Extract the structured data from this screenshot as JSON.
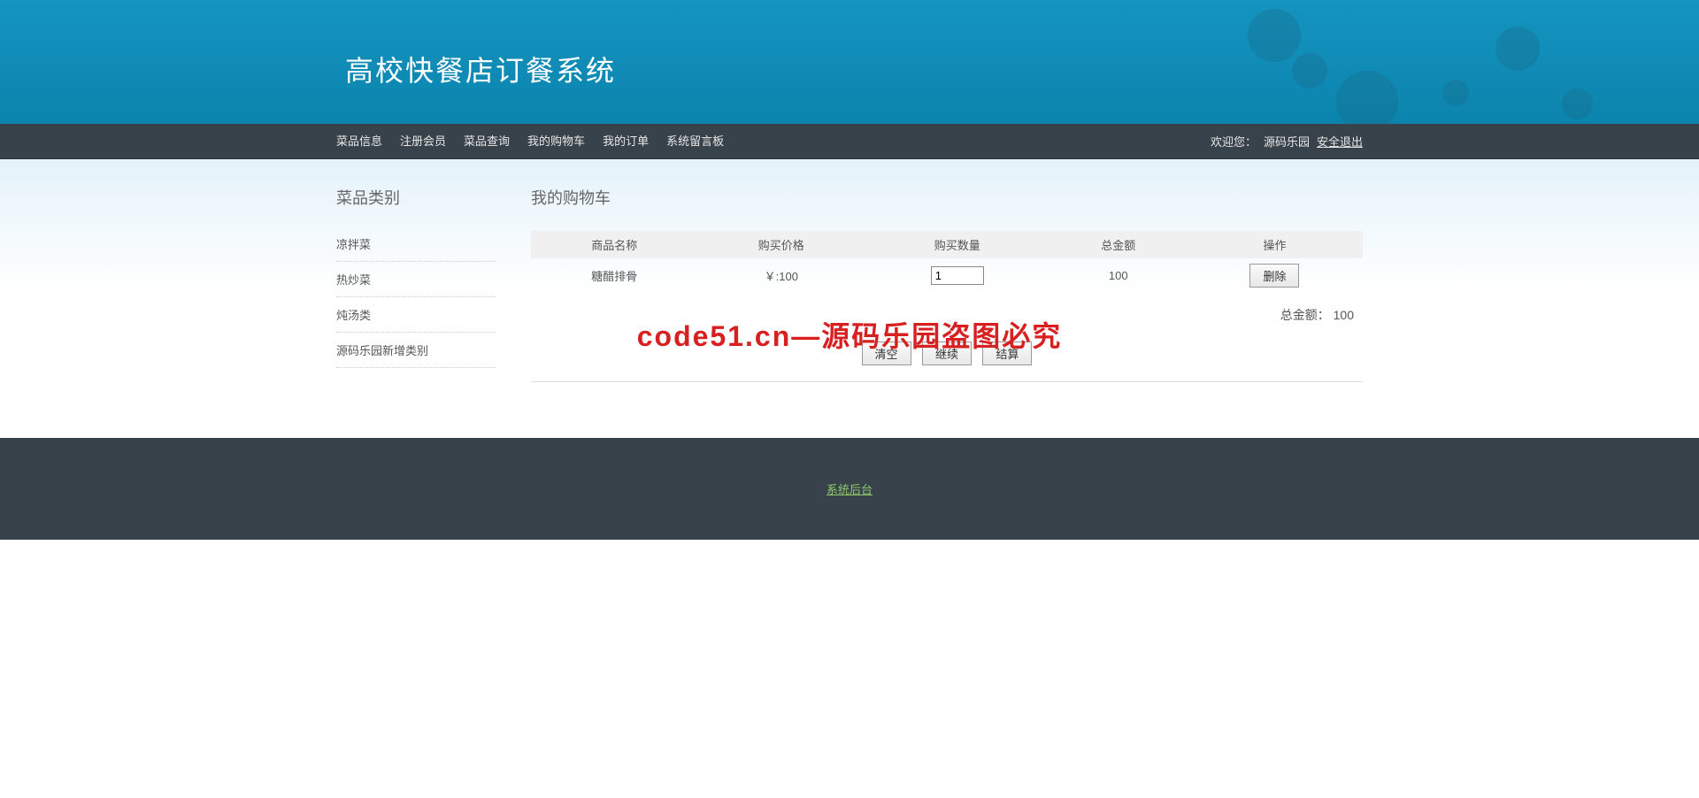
{
  "header": {
    "title": "高校快餐店订餐系统"
  },
  "nav": {
    "items": [
      "菜品信息",
      "注册会员",
      "菜品查询",
      "我的购物车",
      "我的订单",
      "系统留言板"
    ],
    "welcome_prefix": "欢迎您：",
    "username": "源码乐园",
    "logout": "安全退出"
  },
  "sidebar": {
    "title": "菜品类别",
    "items": [
      "凉拌菜",
      "热炒菜",
      "炖汤类",
      "源码乐园新增类别"
    ]
  },
  "content": {
    "title": "我的购物车",
    "headers": [
      "商品名称",
      "购买价格",
      "购买数量",
      "总金额",
      "操作"
    ],
    "rows": [
      {
        "name": "糖醋排骨",
        "price": "￥:100",
        "qty": "1",
        "amount": "100",
        "action": "删除"
      }
    ],
    "total_label": "总金额：",
    "total_value": "100",
    "buttons": {
      "clear": "清空",
      "continue": "继续",
      "checkout": "结算"
    }
  },
  "footer": {
    "link": "系统后台"
  },
  "watermark": "code51.cn—源码乐园盗图必究"
}
